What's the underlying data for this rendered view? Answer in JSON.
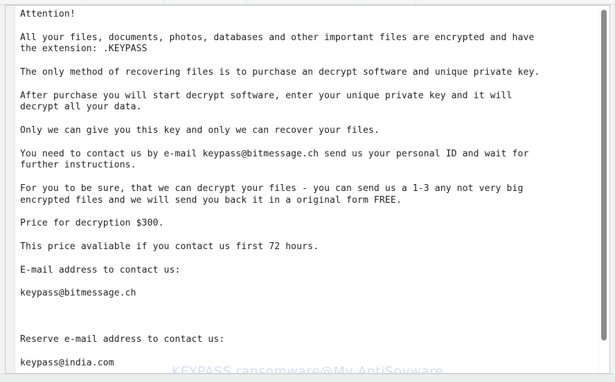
{
  "window": {
    "kind": "ransom-note-text-window",
    "background": "#ffffff",
    "border_color": "#c9cbcd"
  },
  "note": {
    "lines": [
      "Attention!",
      "",
      "All your files, documents, photos, databases and other important files are encrypted and have",
      "the extension: .KEYPASS",
      "",
      "The only method of recovering files is to purchase an decrypt software and unique private key.",
      "",
      "After purchase you will start decrypt software, enter your unique private key and it will",
      "decrypt all your data.",
      "",
      "Only we can give you this key and only we can recover your files.",
      "",
      "You need to contact us by e-mail keypass@bitmessage.ch send us your personal ID and wait for",
      "further instructions.",
      "",
      "For you to be sure, that we can decrypt your files - you can send us a 1-3 any not very big",
      "encrypted files and we will send you back it in a original form FREE.",
      "",
      "Price for decryption $300.",
      "",
      "This price avaliable if you contact us first 72 hours.",
      "",
      "E-mail address to contact us:",
      "",
      "keypass@bitmessage.ch",
      "",
      "",
      "",
      "Reserve e-mail address to contact us:",
      "",
      "keypass@india.com"
    ],
    "extension": ".KEYPASS",
    "price": "$300",
    "deadline_hours": "72",
    "primary_email": "keypass@bitmessage.ch",
    "reserve_email": "keypass@india.com",
    "test_file_count": "1-3",
    "text_color": "#1b1b1b"
  },
  "scrollbar": {
    "orientation": "vertical",
    "thumb_color": "#8b8b8b",
    "track_color": "#ffffff"
  },
  "watermark": {
    "text": "KEYPASS ransomware@My AntiSpyware",
    "color": "#ccd9ec"
  },
  "chrome": {
    "top_strip_color": "#f5f5f5",
    "bottom_strip_color": "#eceded"
  }
}
